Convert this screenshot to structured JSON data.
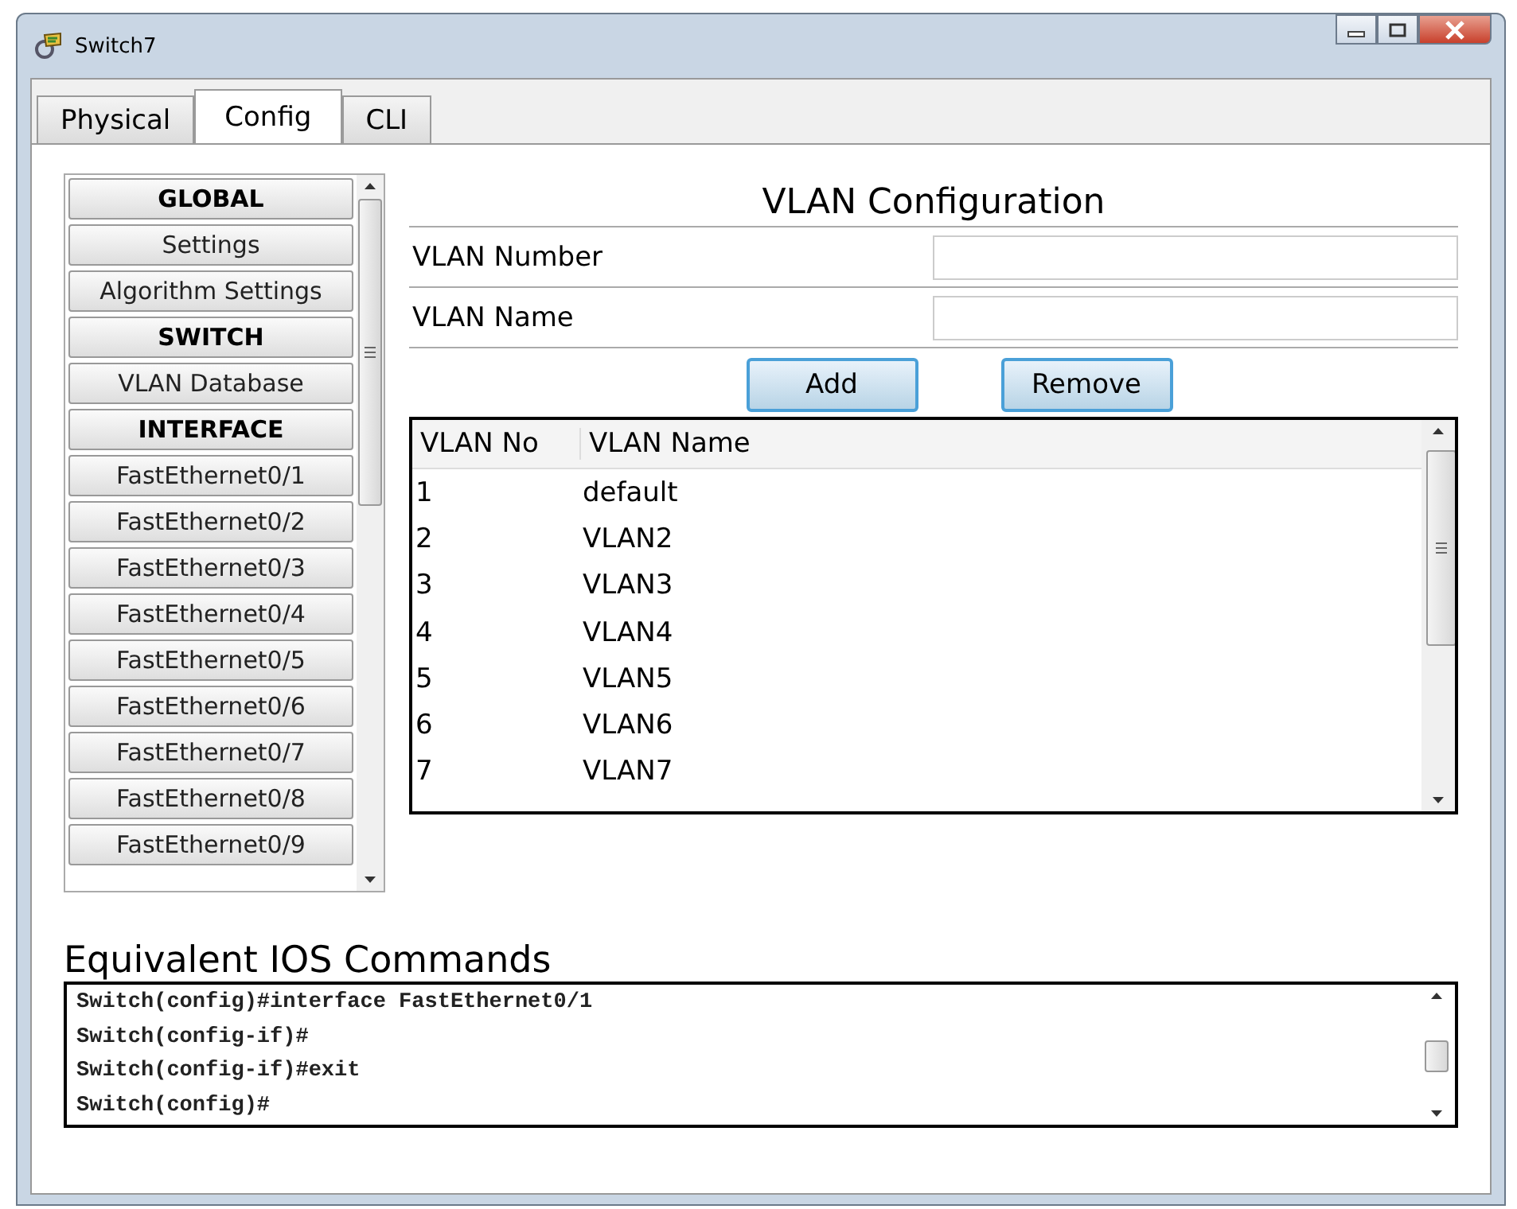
{
  "window": {
    "title": "Switch7"
  },
  "tabs": [
    {
      "label": "Physical",
      "selected": false
    },
    {
      "label": "Config",
      "selected": true
    },
    {
      "label": "CLI",
      "selected": false
    }
  ],
  "sidebar": {
    "items": [
      {
        "label": "GLOBAL",
        "kind": "header"
      },
      {
        "label": "Settings",
        "kind": "item"
      },
      {
        "label": "Algorithm Settings",
        "kind": "item"
      },
      {
        "label": "SWITCH",
        "kind": "header"
      },
      {
        "label": "VLAN Database",
        "kind": "item"
      },
      {
        "label": "INTERFACE",
        "kind": "header"
      },
      {
        "label": "FastEthernet0/1",
        "kind": "item"
      },
      {
        "label": "FastEthernet0/2",
        "kind": "item"
      },
      {
        "label": "FastEthernet0/3",
        "kind": "item"
      },
      {
        "label": "FastEthernet0/4",
        "kind": "item"
      },
      {
        "label": "FastEthernet0/5",
        "kind": "item"
      },
      {
        "label": "FastEthernet0/6",
        "kind": "item"
      },
      {
        "label": "FastEthernet0/7",
        "kind": "item"
      },
      {
        "label": "FastEthernet0/8",
        "kind": "item"
      },
      {
        "label": "FastEthernet0/9",
        "kind": "item"
      }
    ]
  },
  "vlan_config": {
    "title": "VLAN Configuration",
    "fields": [
      {
        "label": "VLAN Number"
      },
      {
        "label": "VLAN Name"
      }
    ],
    "buttons": [
      "Add",
      "Remove"
    ],
    "table": {
      "columns": [
        "VLAN No",
        "VLAN Name"
      ],
      "rows": [
        [
          "1",
          "default"
        ],
        [
          "2",
          "VLAN2"
        ],
        [
          "3",
          "VLAN3"
        ],
        [
          "4",
          "VLAN4"
        ],
        [
          "5",
          "VLAN5"
        ],
        [
          "6",
          "VLAN6"
        ],
        [
          "7",
          "VLAN7"
        ]
      ]
    }
  },
  "ios_commands": {
    "title": "Equivalent IOS Commands",
    "lines": [
      "Switch(config)#interface FastEthernet0/1",
      "Switch(config-if)#",
      "Switch(config-if)#exit",
      "Switch(config)#"
    ]
  }
}
